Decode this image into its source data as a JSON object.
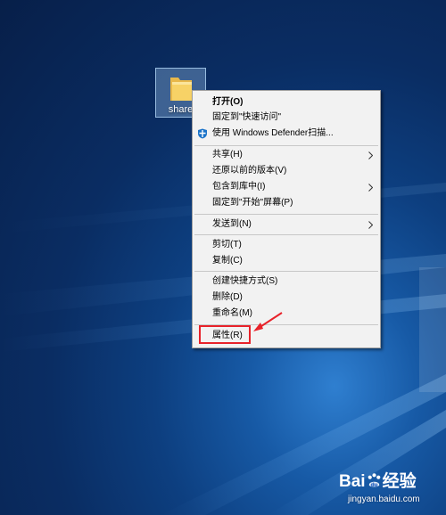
{
  "desktop": {
    "folder": {
      "label": "share"
    }
  },
  "context_menu": {
    "items": [
      {
        "label": "打开(O)"
      },
      {
        "label": "固定到\"快速访问\""
      },
      {
        "label": "使用 Windows Defender扫描..."
      },
      {
        "label": "共享(H)"
      },
      {
        "label": "还原以前的版本(V)"
      },
      {
        "label": "包含到库中(I)"
      },
      {
        "label": "固定到\"开始\"屏幕(P)"
      },
      {
        "label": "发送到(N)"
      },
      {
        "label": "剪切(T)"
      },
      {
        "label": "复制(C)"
      },
      {
        "label": "创建快捷方式(S)"
      },
      {
        "label": "删除(D)"
      },
      {
        "label": "重命名(M)"
      },
      {
        "label": "属性(R)"
      }
    ]
  },
  "annotation": {
    "highlight_color": "#e8222a"
  },
  "watermark": {
    "brand_left": "Bai",
    "brand_right": "经验",
    "url": "jingyan.baidu.com"
  },
  "colors": {
    "menu_background": "#f2f2f2",
    "desktop_blue": "#0d3f80",
    "folder_yellow": "#f7d266"
  }
}
